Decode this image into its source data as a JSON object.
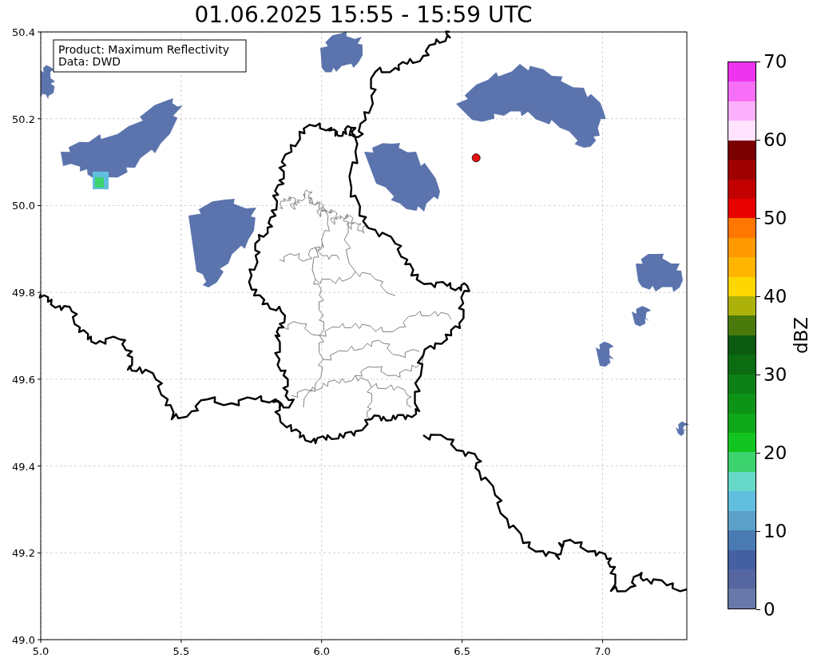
{
  "chart_data": {
    "type": "scatter",
    "title": "01.06.2025 15:55 - 15:59 UTC",
    "xlim": [
      5,
      7.3
    ],
    "ylim": [
      49,
      50.4
    ],
    "grid": true,
    "xticks": [
      {
        "value": 5,
        "label": "5.0"
      },
      {
        "value": 5.5,
        "label": "5.5"
      },
      {
        "value": 6,
        "label": "6.0"
      },
      {
        "value": 6.5,
        "label": "6.5"
      },
      {
        "value": 7,
        "label": "7.0"
      }
    ],
    "yticks": [
      {
        "value": 49,
        "label": "49.0"
      },
      {
        "value": 49.2,
        "label": "49.2"
      },
      {
        "value": 49.4,
        "label": "49.4"
      },
      {
        "value": 49.6,
        "label": "49.6"
      },
      {
        "value": 49.8,
        "label": "49.8"
      },
      {
        "value": 50,
        "label": "50.0"
      },
      {
        "value": 50.2,
        "label": "50.2"
      },
      {
        "value": 50.4,
        "label": "50.4"
      }
    ],
    "x": [
      6.55
    ],
    "series": [
      {
        "color": "#e81010",
        "values": [
          50.11
        ]
      }
    ]
  },
  "info_box": {
    "lines": [
      "Product: Maximum Reflectivity",
      "Data: DWD"
    ]
  },
  "colorbar": {
    "label": "dBZ",
    "ticks": [
      "70",
      "60",
      "50",
      "40",
      "30",
      "20",
      "10",
      "0"
    ],
    "bins": [
      {
        "color": "#ee33ee"
      },
      {
        "color": "#f76ef7"
      },
      {
        "color": "#fcb0fc"
      },
      {
        "color": "#fee2fe"
      },
      {
        "color": "#7a0000"
      },
      {
        "color": "#9e0000"
      },
      {
        "color": "#c20000"
      },
      {
        "color": "#e60000"
      },
      {
        "color": "#ff7700"
      },
      {
        "color": "#ff9900"
      },
      {
        "color": "#ffb400"
      },
      {
        "color": "#ffd700"
      },
      {
        "color": "#adb20a"
      },
      {
        "color": "#4a7a0c"
      },
      {
        "color": "#0a5a10"
      },
      {
        "color": "#0b6c12"
      },
      {
        "color": "#0c8014"
      },
      {
        "color": "#0d9316"
      },
      {
        "color": "#0fa81a"
      },
      {
        "color": "#12c41f"
      },
      {
        "color": "#3dd36e"
      },
      {
        "color": "#66d8c8"
      },
      {
        "color": "#62bede"
      },
      {
        "color": "#5aa0c8"
      },
      {
        "color": "#4a7ab2"
      },
      {
        "color": "#4460a2"
      },
      {
        "color": "#5566a0"
      },
      {
        "color": "#6878a8"
      }
    ]
  }
}
